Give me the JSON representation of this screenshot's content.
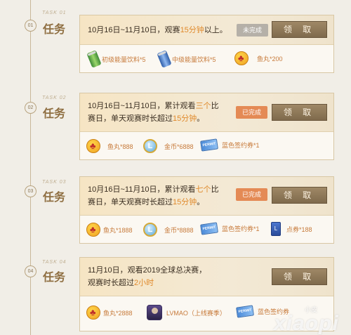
{
  "tasks": [
    {
      "num": "01",
      "eng": "TASK 01",
      "title": "任务",
      "desc_parts": [
        "10月16日~11月10日，观赛",
        "15分钟",
        "以上。"
      ],
      "status": "未完成",
      "button": "领 取",
      "rewards": [
        {
          "icon": "green-energy-drink-icon",
          "label": "初级能量饮料*5"
        },
        {
          "icon": "blue-energy-drink-icon",
          "label": "中级能量饮料*5"
        },
        {
          "icon": "fishball-icon",
          "label": "鱼丸*200"
        }
      ]
    },
    {
      "num": "02",
      "eng": "TASK 02",
      "title": "任务",
      "desc_line1": [
        "10月16日~11月10日，累计观看",
        "三个",
        "比"
      ],
      "desc_line2": [
        "赛日，单天观赛时长超过",
        "15分钟",
        "。"
      ],
      "status": "已完成",
      "button": "领 取",
      "rewards": [
        {
          "icon": "fishball-icon",
          "label": "鱼丸*888"
        },
        {
          "icon": "gold-coin-icon",
          "label": "金币*6888"
        },
        {
          "icon": "blue-ticket-icon",
          "label": "蓝色签约券*1"
        }
      ]
    },
    {
      "num": "03",
      "eng": "TASK 03",
      "title": "任务",
      "desc_line1": [
        "10月16日~11月10日，累计观看",
        "七个",
        "比"
      ],
      "desc_line2": [
        "赛日，单天观赛时长超过",
        "15分钟",
        "。"
      ],
      "status": "已完成",
      "button": "领 取",
      "rewards": [
        {
          "icon": "fishball-icon",
          "label": "鱼丸*1888"
        },
        {
          "icon": "gold-coin-icon",
          "label": "金币*8888"
        },
        {
          "icon": "blue-ticket-icon",
          "label": "蓝色签约券*1"
        },
        {
          "icon": "point-voucher-icon",
          "label": "点券*188"
        }
      ]
    },
    {
      "num": "04",
      "eng": "TASK 04",
      "title": "任务",
      "desc_line1": [
        "11月10日，观看2019全球总决赛，"
      ],
      "desc_line2": [
        "观赛时长超过",
        "2小时"
      ],
      "button": "领 取",
      "rewards": [
        {
          "icon": "fishball-icon",
          "label": "鱼丸*2888"
        },
        {
          "icon": "avatar-icon",
          "label": "LVMAO（上线赛季）"
        },
        {
          "icon": "blue-ticket-icon",
          "label": "蓝色签约券"
        }
      ]
    }
  ],
  "coin_glyph": "L",
  "ticket_text": "PERMIT",
  "voucher_text": "L",
  "watermark": {
    "main": "xiaopi",
    "small": "小皮"
  }
}
